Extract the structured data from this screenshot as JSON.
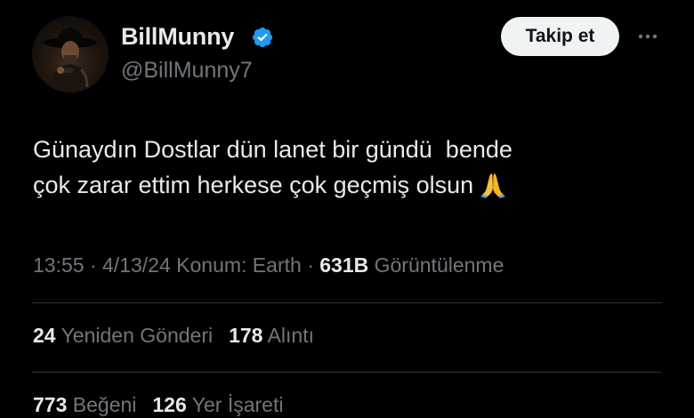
{
  "author": {
    "display_name": "BillMunny",
    "handle": "@BillMunny7",
    "verified": true
  },
  "actions": {
    "follow_label": "Takip et",
    "more_label": "···"
  },
  "tweet": {
    "line1": "Günaydın Dostlar dün lanet bir gündü  bende",
    "line2": "çok zarar ettim herkese çok geçmiş olsun",
    "emoji": "folded-hands-emoji"
  },
  "meta": {
    "time": "13:55",
    "sep1": "·",
    "date": "4/13/24",
    "location": "Konum: Earth",
    "sep2": "·",
    "views_count": "631B",
    "views_label": "Görüntülenme"
  },
  "stats": {
    "reposts_count": "24",
    "reposts_label": "Yeniden Gönderi",
    "quotes_count": "178",
    "quotes_label": "Alıntı",
    "likes_count": "773",
    "likes_label": "Beğeni",
    "bookmarks_count": "126",
    "bookmarks_label": "Yer İşareti"
  },
  "colors": {
    "background": "#000000",
    "text_primary": "#e7e9ea",
    "text_secondary": "#71767b",
    "verified_blue": "#1d9bf0",
    "divider": "#2f3336",
    "follow_bg": "#eff3f4"
  }
}
